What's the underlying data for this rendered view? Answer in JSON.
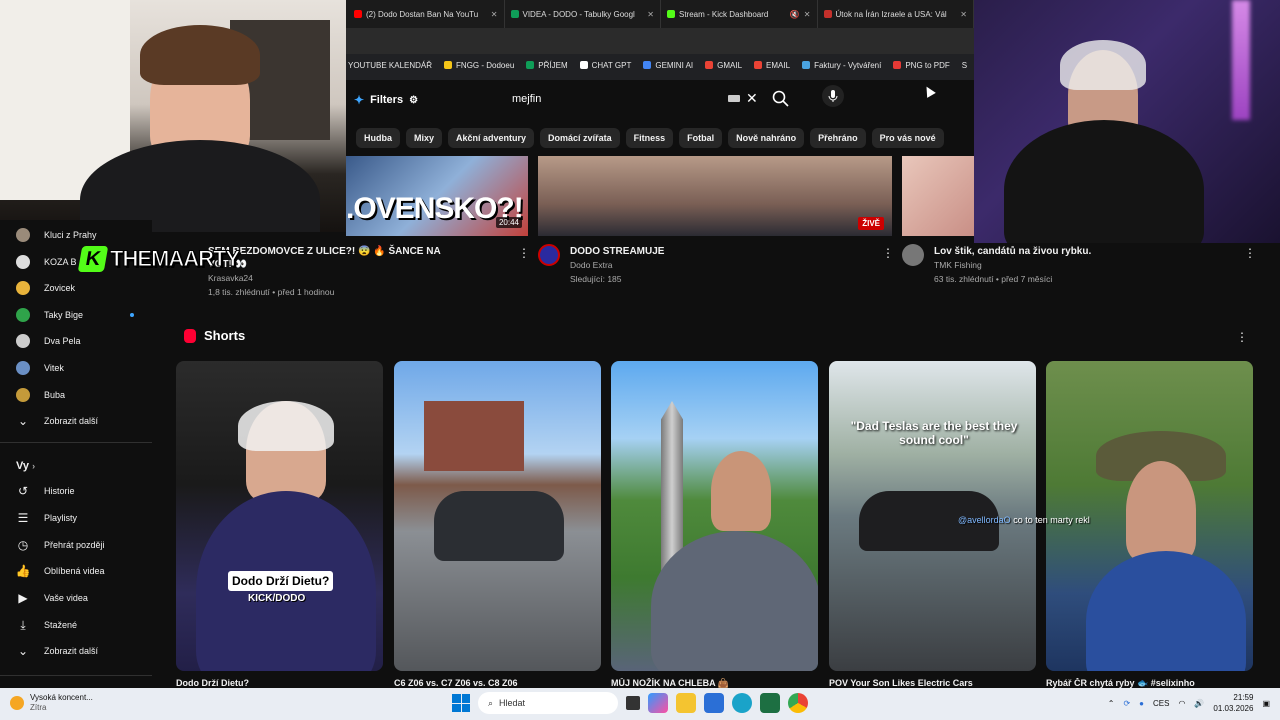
{
  "browser": {
    "tabs": [
      {
        "label": "(2) Dodo Dostan Ban Na YouTu",
        "color": "#ff0000"
      },
      {
        "label": "VIDEA - DODO - Tabulky Googl",
        "color": "#0f9d58"
      },
      {
        "label": "Stream - Kick Dashboard",
        "color": "#53fc18"
      },
      {
        "label": "Útok na Írán Izraele a USA: Vál",
        "color": "#c4302b"
      }
    ],
    "bookmarks": [
      {
        "label": "YOUTUBE KALENDÁŘ",
        "color": ""
      },
      {
        "label": "FNGG - Dodoeu",
        "color": "#f5c518"
      },
      {
        "label": "PŘÍJEM",
        "color": "#0f9d58"
      },
      {
        "label": "CHAT GPT",
        "color": "#ffffff"
      },
      {
        "label": "GEMINI AI",
        "color": "#4285f4"
      },
      {
        "label": "GMAIL",
        "color": "#ea4335"
      },
      {
        "label": "EMAIL",
        "color": "#ea4335"
      },
      {
        "label": "Faktury - Vytváření",
        "color": "#4aa3df"
      },
      {
        "label": "PNG to PDF",
        "color": "#e53935"
      },
      {
        "label": "S",
        "color": "#ffffff"
      }
    ]
  },
  "youtube": {
    "filters_label": "Filters",
    "search_value": "mejfin",
    "chips": [
      "Hudba",
      "Mixy",
      "Akční adventury",
      "Domácí zvířata",
      "Fitness",
      "Fotbal",
      "Nově nahráno",
      "Přehráno",
      "Pro vás nové"
    ],
    "thumb1_overlay": ".OVENSKO?!",
    "thumb1_duration": "20:44",
    "thumb2_live": "ŽIVĚ",
    "videos": [
      {
        "title_line1": "SEM BEZDOMOVCE Z ULICE?! 😨 🔥 ŠANCE NA",
        "title_line2": "VOT! 👀",
        "channel": "Krasavka24",
        "meta": "1,8 tis. zhlédnutí • před 1 hodinou"
      },
      {
        "title_line1": "DODO STREAMUJE",
        "title_line2": "",
        "channel": "Dodo Extra",
        "meta": "Sledující: 185"
      },
      {
        "title_line1": "Lov štik, candátů na živou rybku.",
        "title_line2": "",
        "channel": "TMK Fishing",
        "meta": "63 tis. zhlédnutí • před 7 měsíci"
      }
    ],
    "shorts_heading": "Shorts",
    "shorts": [
      {
        "title": "Dodo Drží Dietu?",
        "caption": "Dodo Drží Dietu?",
        "kick": "KICK/DODO"
      },
      {
        "title": "C6 Z06 vs. C7 Z06 vs. C8 Z06"
      },
      {
        "title": "MŮJ NOŽÍK NA CHLEBA 👜"
      },
      {
        "title": "POV Your Son Likes Electric Cars",
        "overlay": "\"Dad Teslas are the best they sound cool\""
      },
      {
        "title": "Rybář ČR chytá ryby 🐟 #selixinho"
      }
    ]
  },
  "sidebar": {
    "subs": [
      {
        "label": "Kluci z Prahy",
        "color": "#9a8b7a"
      },
      {
        "label": "KOZA B",
        "color": "#dddddd"
      },
      {
        "label": "Zovicek",
        "color": "#e8b33b"
      },
      {
        "label": "Taky Bige",
        "color": "#2fa34a"
      },
      {
        "label": "Dva Pela",
        "color": "#cccccc"
      },
      {
        "label": "Vitek",
        "color": "#6a8fc4"
      },
      {
        "label": "Buba",
        "color": "#c49a3a"
      }
    ],
    "show_more": "Zobrazit další",
    "you_heading": "Vy",
    "you_items": [
      {
        "label": "Historie",
        "icon": "history-icon",
        "glyph": "↺"
      },
      {
        "label": "Playlisty",
        "icon": "playlist-icon",
        "glyph": "☰"
      },
      {
        "label": "Přehrát později",
        "icon": "clock-icon",
        "glyph": "◷"
      },
      {
        "label": "Oblíbená videa",
        "icon": "thumbs-up-icon",
        "glyph": "👍"
      },
      {
        "label": "Vaše videa",
        "icon": "video-icon",
        "glyph": "▶"
      },
      {
        "label": "Stažené",
        "icon": "download-icon",
        "glyph": "⤓"
      },
      {
        "label": "Zobrazit další",
        "icon": "chevron-down-icon",
        "glyph": "⌄"
      }
    ]
  },
  "overlay": {
    "streamer_name": "THEMAARTY",
    "chat_user": "@avellordaO",
    "chat_text": "co to ten marty rekl"
  },
  "taskbar": {
    "weather_title": "Vysoká koncent...",
    "weather_sub": "Zítra",
    "search_placeholder": "Hledat",
    "lang": "CES",
    "time": "21:59",
    "date": "01.03.2026"
  }
}
